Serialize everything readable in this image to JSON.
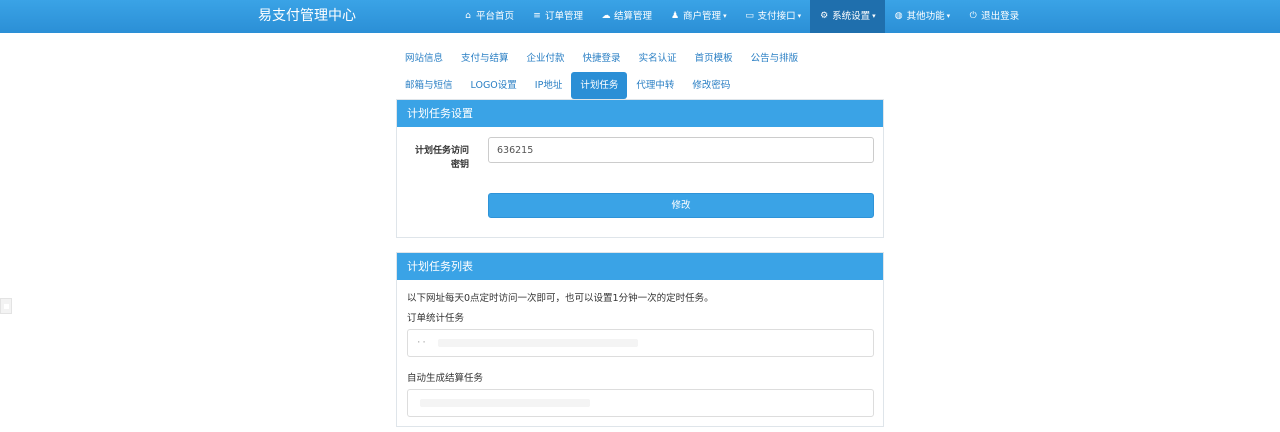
{
  "navbar": {
    "brand": "易支付管理中心",
    "items": [
      {
        "label": "平台首页",
        "icon": "home-icon",
        "glyph": "⌂",
        "caret": ""
      },
      {
        "label": "订单管理",
        "icon": "list-icon",
        "glyph": "≡",
        "caret": ""
      },
      {
        "label": "结算管理",
        "icon": "cloud-icon",
        "glyph": "☁",
        "caret": ""
      },
      {
        "label": "商户管理",
        "icon": "user-icon",
        "glyph": "♟",
        "caret": "▾"
      },
      {
        "label": "支付接口",
        "icon": "credit-card-icon",
        "glyph": "▭",
        "caret": "▾"
      },
      {
        "label": "系统设置",
        "icon": "gear-icon",
        "glyph": "⚙",
        "caret": "▾"
      },
      {
        "label": "其他功能",
        "icon": "globe-icon",
        "glyph": "◍",
        "caret": "▾"
      },
      {
        "label": "退出登录",
        "icon": "power-icon",
        "glyph": "⏻",
        "caret": ""
      }
    ]
  },
  "tabs": {
    "row1": [
      "网站信息",
      "支付与结算",
      "企业付款",
      "快捷登录",
      "实名认证",
      "首页模板",
      "公告与排版"
    ],
    "row2": [
      "邮箱与短信",
      "LOGO设置",
      "IP地址",
      "计划任务",
      "代理中转",
      "修改密码"
    ]
  },
  "settings_panel": {
    "title": "计划任务设置",
    "key_label": "计划任务访问密钥",
    "key_value": "636215",
    "submit_label": "修改"
  },
  "list_panel": {
    "title": "计划任务列表",
    "description": "以下网址每天0点定时访问一次即可，也可以设置1分钟一次的定时任务。",
    "task1_label": "订单统计任务",
    "task1_url": "··",
    "task2_label": "自动生成结算任务",
    "task2_url": ""
  },
  "colors": {
    "navbar": "#2b8fd6",
    "active_nav": "#1f6fad",
    "panel_heading": "#3aa3e6",
    "link": "#2a7fc4"
  }
}
